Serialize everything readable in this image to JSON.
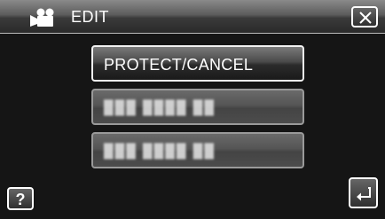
{
  "header": {
    "title": "EDIT",
    "mode_icon": "video-camera-icon",
    "close_icon": "close-icon"
  },
  "menu": {
    "items": [
      {
        "label": "PROTECT/CANCEL",
        "state": "active"
      },
      {
        "label": "███ ████ ██",
        "state": "obscured"
      },
      {
        "label": "███ ████ ██",
        "state": "obscured"
      }
    ]
  },
  "footer": {
    "help_label": "?",
    "back_icon": "return-arrow-icon"
  },
  "colors": {
    "background": "#151515",
    "button_border": "#cfcfcf",
    "text": "#ffffff"
  }
}
